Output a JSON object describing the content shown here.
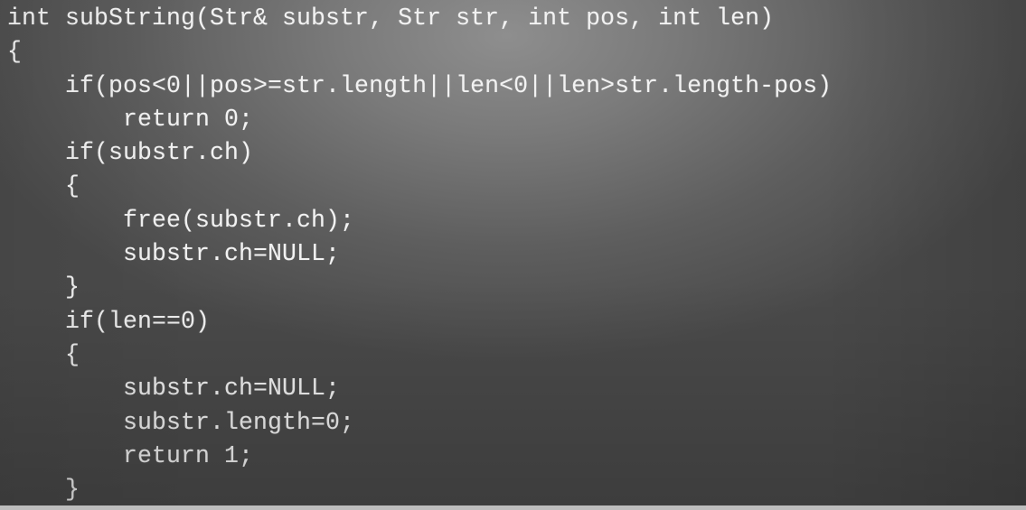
{
  "code": {
    "lines": [
      "int subString(Str& substr, Str str, int pos, int len)",
      "{",
      "    if(pos<0||pos>=str.length||len<0||len>str.length-pos)",
      "        return 0;",
      "    if(substr.ch)",
      "    {",
      "        free(substr.ch);",
      "        substr.ch=NULL;",
      "    }",
      "    if(len==0)",
      "    {",
      "        substr.ch=NULL;",
      "        substr.length=0;",
      "        return 1;",
      "    }"
    ]
  }
}
